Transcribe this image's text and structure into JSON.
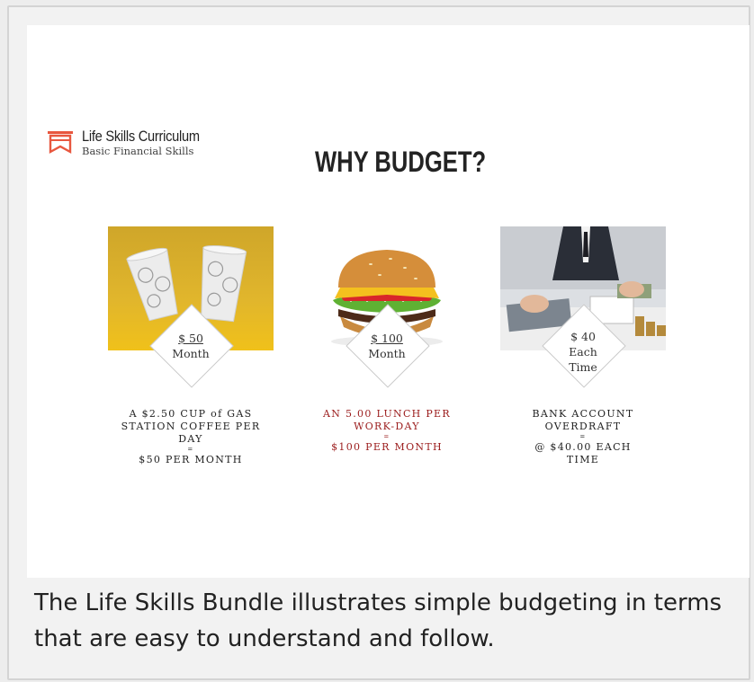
{
  "logo": {
    "title": "Life Skills Curriculum",
    "subtitle": "Basic Financial Skills",
    "icon": "book-logo-icon",
    "color": "#e8573f"
  },
  "heading": "WHY BUDGET?",
  "cards": [
    {
      "image": "coffee-cups-image",
      "badge_amount": "$ 50",
      "badge_unit": "Month",
      "caption_line1": "A $2.50 CUP of GAS STATION COFFEE PER DAY",
      "caption_eq": "=",
      "caption_line2": "$50 PER MONTH",
      "caption_color": "#222222"
    },
    {
      "image": "hamburger-image",
      "badge_amount": "$ 100",
      "badge_unit": "Month",
      "caption_line1": "AN 5.00 LUNCH PER WORK-DAY",
      "caption_eq": "=",
      "caption_line2": "$100 PER MONTH",
      "caption_color": "#9b1c1c"
    },
    {
      "image": "calculator-money-image",
      "badge_amount": "$ 40",
      "badge_unit": "Each Time",
      "caption_line1": "BANK ACCOUNT OVERDRAFT",
      "caption_eq": "=",
      "caption_line2": "@ $40.00 EACH TIME",
      "caption_color": "#222222"
    }
  ],
  "footer": {
    "text": "The Life Skills Bundle illustrates simple budgeting in terms that are easy to understand and follow."
  }
}
